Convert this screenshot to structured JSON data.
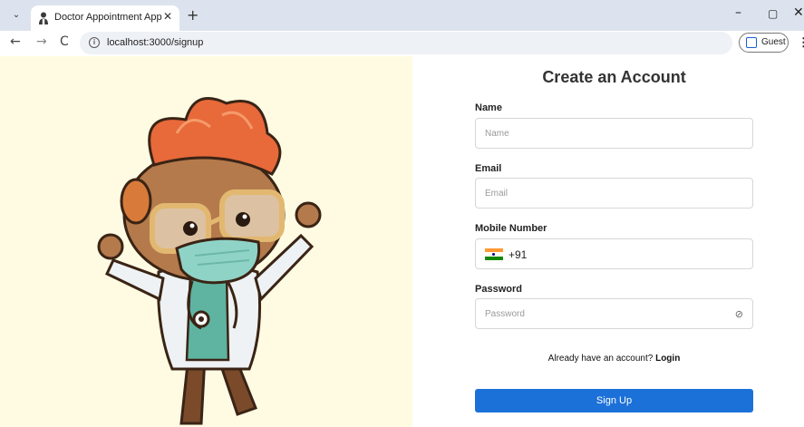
{
  "browser": {
    "tab_title": "Doctor Appointment App",
    "tab_menu_glyph": "⌄",
    "tab_close_glyph": "✕",
    "new_tab_glyph": "+",
    "window_controls": {
      "minimize": "–",
      "restore": "▢",
      "close": "✕"
    },
    "nav": {
      "back": "←",
      "forward": "→",
      "reload": "C"
    },
    "url": "localhost:3000/signup",
    "profile_label": "Guest",
    "menu_glyph": "⋮"
  },
  "signup_form": {
    "title": "Create an Account",
    "name": {
      "label": "Name",
      "placeholder": "Name"
    },
    "email": {
      "label": "Email",
      "placeholder": "Email"
    },
    "mobile": {
      "label": "Mobile Number",
      "dial_code": "+91",
      "country_flag_icon": "india-flag-icon"
    },
    "password": {
      "label": "Password",
      "placeholder": "Password",
      "toggle_icon": "eye-slash-icon",
      "toggle_glyph": "⊘"
    },
    "login_prompt": "Already have an account?",
    "login_link": "Login",
    "submit_label": "Sign Up"
  },
  "colors": {
    "hero_background": "#fffbe3",
    "primary_button": "#1c71d8",
    "tab_strip": "#dde3ee"
  }
}
